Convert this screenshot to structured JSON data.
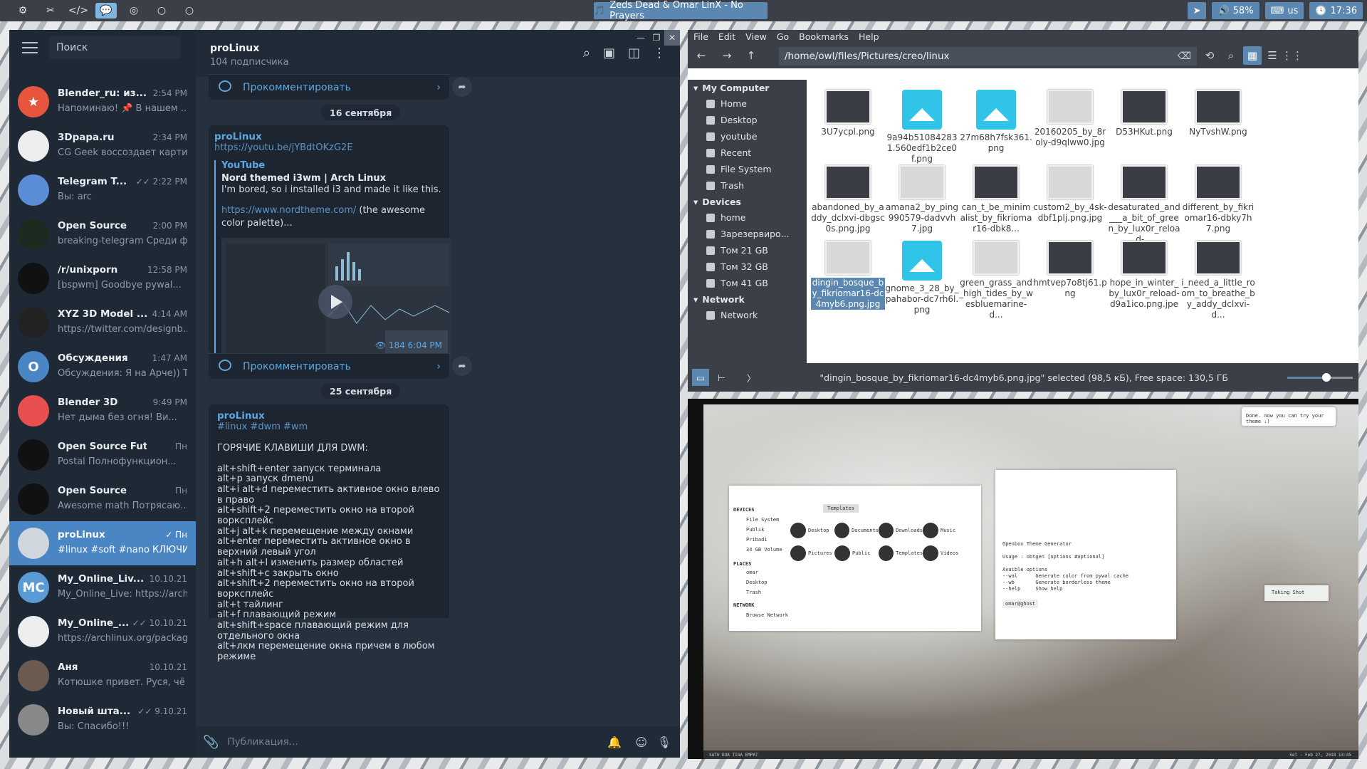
{
  "topbar": {
    "workspaces": [
      "⚙",
      "✂",
      "</>",
      "💬",
      "◎",
      "○",
      "○"
    ],
    "active_ws": 3,
    "title": "Zeds Dead & Omar LinX - No Prayers",
    "battery": "58%",
    "lang": "us",
    "clock": "17:36"
  },
  "telegram": {
    "search_placeholder": "Поиск",
    "chats": [
      {
        "name": "Blender_ru: из...",
        "time": "2:54 PM",
        "msg": "Напоминаю! 📌 В нашем ...",
        "color": "#e8553d",
        "initial": "★"
      },
      {
        "name": "3Dpapa.ru",
        "time": "2:34 PM",
        "msg": "CG Geek воссоздает карти...",
        "color": "#eeeeee",
        "initial": ""
      },
      {
        "name": "Telegram T...",
        "time": "✓✓ 2:22 PM",
        "msg": "Вы: arc",
        "color": "#5b8dd6",
        "initial": ""
      },
      {
        "name": "Open Source",
        "time": "2:00 PM",
        "msg": "breaking-telegram  Среди ф...",
        "color": "#1b2b20",
        "initial": ""
      },
      {
        "name": "/r/unixporn",
        "time": "12:58 PM",
        "msg": "[bspwm] Goodbye pywal...",
        "color": "#111",
        "initial": ""
      },
      {
        "name": "XYZ 3D Model ...",
        "time": "4:14 AM",
        "msg": "https://twitter.com/designb...",
        "color": "#222",
        "initial": ""
      },
      {
        "name": "Обсуждения",
        "time": "1:47 AM",
        "msg": "Обсуждения: Я на Арче)) Т...",
        "color": "#4a86c4",
        "initial": "O"
      },
      {
        "name": "Blender 3D",
        "time": "9:49 PM",
        "msg": "Нет дыма без огня! Ви...",
        "color": "#e84f4f",
        "initial": ""
      },
      {
        "name": "Open Source Future",
        "time": "Пн",
        "msg": "Postal  Полнофункцион...",
        "color": "#111",
        "initial": ""
      },
      {
        "name": "Open Source",
        "time": "Пн",
        "msg": "Awesome math  Потрясаю...",
        "color": "#111",
        "initial": ""
      },
      {
        "name": "proLinux",
        "time": "✓ Пн",
        "msg": "#linux #soft #nano  КЛЮЧИ...",
        "color": "#cfd6de",
        "initial": ""
      },
      {
        "name": "My_Online_Liv...",
        "time": "10.10.21",
        "msg": "My_Online_Live: https://arch...",
        "color": "#5b9bd5",
        "initial": "MC"
      },
      {
        "name": "My_Online_...",
        "time": "✓✓ 10.10.21",
        "msg": "https://archlinux.org/packag...",
        "color": "#eee",
        "initial": ""
      },
      {
        "name": "Аня",
        "time": "10.10.21",
        "msg": "Котюшке привет. Руся, чё з...",
        "color": "#6b5a50",
        "initial": ""
      },
      {
        "name": "Новый шта...",
        "time": "✓✓ 9.10.21",
        "msg": "Вы: Спасибо!!!",
        "color": "#888",
        "initial": ""
      }
    ],
    "channel": {
      "title": "proLinux",
      "subscribers": "104 подписчика"
    },
    "comment_label": "Прокомментировать",
    "date1": "16 сентября",
    "date2": "25 сентября",
    "post1": {
      "author": "proLinux",
      "link": "https://youtu.be/jYBdtOKzG2E",
      "site": "YouTube",
      "title": "Nord themed i3wm | Arch Linux",
      "desc": "I'm bored, so i installed i3 and made it like this.",
      "desc2_link": "https://www.nordtheme.com/",
      "desc2_rest": "(the awesome color palette)...",
      "views": "👁 184  6:04 PM"
    },
    "post2": {
      "author": "proLinux",
      "tags": "#linux #dwm #wm",
      "heading": "ГОРЯЧИЕ КЛАВИШИ ДЛЯ DWM:",
      "lines": [
        "alt+shift+enter запуск терминала",
        "alt+p запуск dmenu",
        "alt+i alt+d переместить активное окно влево в право",
        "alt+shift+2 переместить окно на второй ворксплейс",
        "alt+j alt+k перемещение между окнами",
        "alt+enter переместить активное окно в верхний левый угол",
        "alt+h alt+l изменить размер областей",
        "alt+shift+c закрыть окно",
        "alt+shift+2 переместить окно на второй ворксплейс",
        "alt+t тайлинг",
        "alt+f плавающий режим",
        "alt+shift+space плавающий режим для отдельного окна",
        "alt+лкм перемещение окна причем в любом режиме"
      ]
    },
    "input_placeholder": "Публикация..."
  },
  "files": {
    "menu": [
      "File",
      "Edit",
      "View",
      "Go",
      "Bookmarks",
      "Help"
    ],
    "path": "/home/owl/files/Pictures/creo/linux",
    "sections": [
      {
        "title": "My Computer",
        "items": [
          "Home",
          "Desktop",
          "youtube",
          "Recent",
          "File System",
          "Trash"
        ]
      },
      {
        "title": "Devices",
        "items": [
          "home",
          "Зарезервиро...",
          "Том 21 GB",
          "Том 32 GB",
          "Том 41 GB"
        ]
      },
      {
        "title": "Network",
        "items": [
          "Network"
        ]
      }
    ],
    "items": [
      {
        "name": "3U7ycpl.png",
        "kind": "dark"
      },
      {
        "name": "9a94b510842831.560edf1b2ce0f.png",
        "kind": "img"
      },
      {
        "name": "27m68h7fsk361.png",
        "kind": "img"
      },
      {
        "name": "20160205_by_8roly-d9qlww0.jpg",
        "kind": "light"
      },
      {
        "name": "D53HKut.png",
        "kind": "dark"
      },
      {
        "name": "NyTvshW.png",
        "kind": "dark"
      },
      {
        "name": "abandoned_by_addy_dclxvi-dbgsc0s.png.jpg",
        "kind": "dark"
      },
      {
        "name": "amana2_by_ping990579-dadvvh7.jpg",
        "kind": "light"
      },
      {
        "name": "can_t_be_minimalist_by_fikriomar16-dbk8...",
        "kind": "dark"
      },
      {
        "name": "custom2_by_4sk-dbf1plj.png.jpg",
        "kind": "light"
      },
      {
        "name": "desaturated_and___a_bit_of_green_by_lux0r_reload-...",
        "kind": "dark"
      },
      {
        "name": "different_by_fikriomar16-dbky7h7.png",
        "kind": "dark"
      },
      {
        "name": "dingin_bosque_by_fikriomar16-dc4myb6.png.jpg",
        "kind": "light",
        "selected": true
      },
      {
        "name": "gnome_3_28_by_pahabor-dc7rh6l.png",
        "kind": "img"
      },
      {
        "name": "green_grass_and_high_tides_by_wesbluemarine-d...",
        "kind": "light"
      },
      {
        "name": "hmtvep7o8tj61.png",
        "kind": "dark"
      },
      {
        "name": "hope_in_winter_by_lux0r_reload-d9a1ico.png.jpe",
        "kind": "dark"
      },
      {
        "name": "i_need_a_little_room_to_breathe_by_addy_dclxvi-d...",
        "kind": "dark"
      }
    ],
    "status": "\"dingin_bosque_by_fikriomar16-dc4myb6.png.jpg\" selected (98,5 кБ), Free space: 130,5 ГБ",
    "zoom_fraction": 0.6
  },
  "preview": {
    "notification": "Done. now you can try your theme :)",
    "devices_label": "DEVICES",
    "places_label": "PLACES",
    "network_label": "NETWORK",
    "dev_items": [
      "File System",
      "Publik",
      "Pribadi",
      "34 GB Volume"
    ],
    "place_items": [
      "omar",
      "Desktop",
      "Trash"
    ],
    "net_items": [
      "Browse Network"
    ],
    "crumb": "Templates",
    "folders": [
      "Desktop",
      "Documents",
      "Downloads",
      "Music",
      "Pictures",
      "Public",
      "Templates",
      "Videos"
    ],
    "term_lines": [
      "Openbox Theme Generator",
      "",
      "Usage : obtgen [options #optional]",
      "",
      "Avaible options",
      "--wal      Generate color from pywal cache",
      "--wb       Generate borderless theme",
      "--help     Show help"
    ],
    "prompt": "omar@ghost",
    "taking_shot": "Taking Shot",
    "bar_left": "SATU  DUA  TIGA  EMPAT",
    "bar_right": "Sel - Feb 27, 2018   13:45"
  }
}
